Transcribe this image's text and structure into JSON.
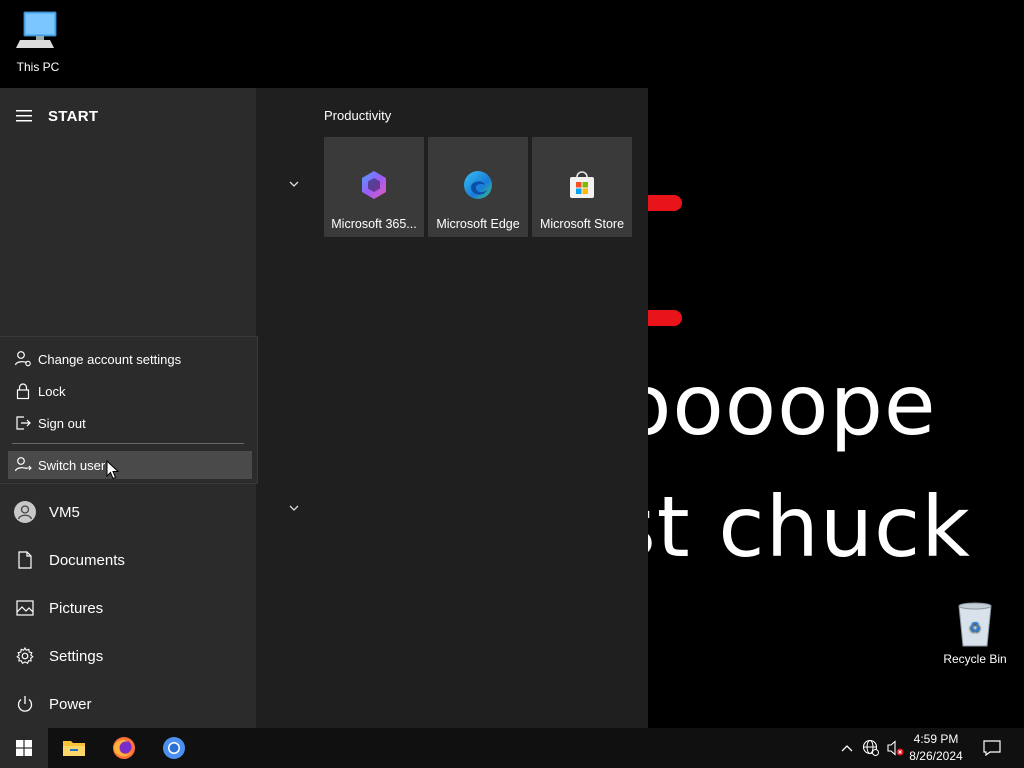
{
  "desktop": {
    "icons": [
      {
        "label": "This PC"
      },
      {
        "label": "Recycle Bin"
      }
    ],
    "wallpaper_text": [
      "oooope",
      "st chuck"
    ],
    "accent_red": "#e8141a"
  },
  "start_menu": {
    "title": "START",
    "account_flyout": {
      "items": [
        {
          "label": "Change account settings",
          "icon": "person-settings-icon"
        },
        {
          "label": "Lock",
          "icon": "lock-icon"
        },
        {
          "label": "Sign out",
          "icon": "sign-out-icon"
        },
        {
          "label": "Switch user",
          "icon": "switch-user-icon"
        }
      ]
    },
    "nav": [
      {
        "label": "VM5",
        "icon": "user-avatar-icon"
      },
      {
        "label": "Documents",
        "icon": "document-icon"
      },
      {
        "label": "Pictures",
        "icon": "pictures-icon"
      },
      {
        "label": "Settings",
        "icon": "gear-icon"
      },
      {
        "label": "Power",
        "icon": "power-icon"
      }
    ],
    "group": {
      "title": "Productivity",
      "tiles": [
        {
          "label": "Microsoft 365...",
          "icon": "microsoft-365-icon"
        },
        {
          "label": "Microsoft Edge",
          "icon": "edge-icon"
        },
        {
          "label": "Microsoft Store",
          "icon": "store-icon"
        }
      ]
    }
  },
  "taskbar": {
    "apps": [
      "start-button",
      "file-explorer",
      "firefox",
      "chromium"
    ],
    "clock": {
      "time": "4:59 PM",
      "date": "8/26/2024"
    }
  },
  "colors": {
    "menu_bg": "#1f1f1f",
    "left_pane_bg": "#2b2b2b",
    "tile_bg": "#3a3a3a",
    "taskbar_bg": "#101010"
  }
}
